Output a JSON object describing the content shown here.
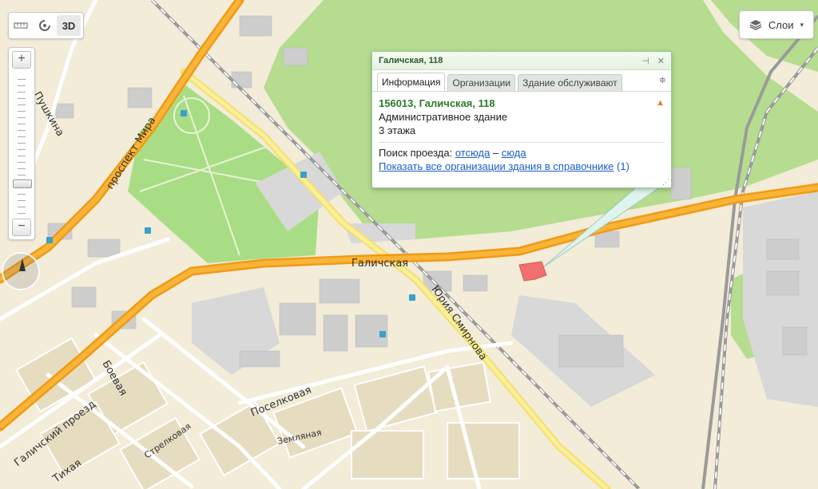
{
  "toolbar": {
    "ruler_icon": "ruler-icon",
    "magnifier_icon": "magnifier-icon",
    "mode_3d_label": "3D"
  },
  "zoom": {
    "plus": "+",
    "minus": "−",
    "level_fraction": 0.22
  },
  "layers": {
    "label": "Слои",
    "caret": "▾"
  },
  "balloon": {
    "title": "Галичская, 118",
    "tabs": [
      "Информация",
      "Организации",
      "Здание обслуживают"
    ],
    "address": "156013, Галичская, 118",
    "building_type": "Административное здание",
    "floors": "3 этажа",
    "route_label": "Поиск проезда:",
    "route_from": "отсюда",
    "route_dash": "–",
    "route_to": "сюда",
    "show_all_link": "Показать все организации здания в справочнике",
    "org_count": "(1)"
  },
  "streets": {
    "galichskaya": "Галичская",
    "yuriya_smirnova": "Юрия Смирнова",
    "prospekt_mira": "проспект Мира",
    "pushkina": "Пушкина",
    "boevaya": "Боевая",
    "poselkovaya": "Поселковая",
    "galichsky_proezd": "Галичский проезд",
    "tikhaya": "Тихая",
    "strelkovaya": "Стрелковая",
    "zemlyanaya": "Земляная"
  },
  "colors": {
    "major_road": "#f6a01a",
    "secondary_road": "#f8e47a",
    "park": "#a9dd85",
    "land": "#f2ecd8",
    "marker": "#f07070"
  }
}
